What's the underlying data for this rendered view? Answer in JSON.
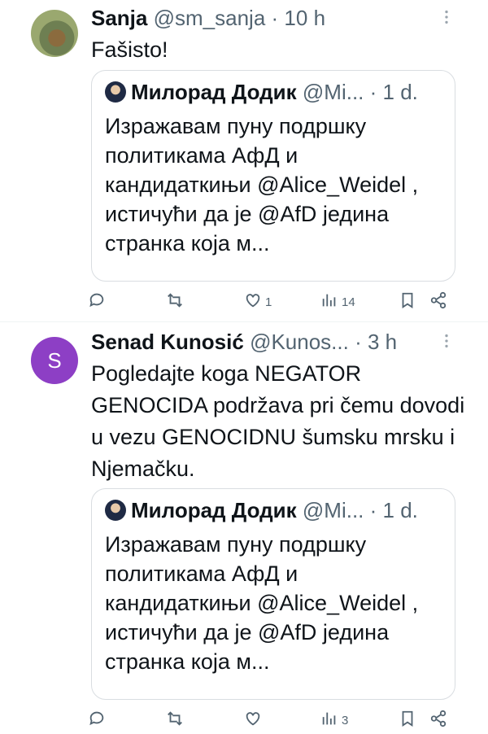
{
  "tweets": [
    {
      "name": "Sanja",
      "handle": "@sm_sanja",
      "sep": "·",
      "time": "10 h",
      "avatar_letter": "",
      "text": "Fašisto!",
      "quote": {
        "name": "Милорад Додик",
        "handle": "@Mi...",
        "sep": "·",
        "time": "1 d.",
        "text": "Изражавам пуну подршку политикама АфД и кандидаткињи @Alice_Weidel , истичући да је @AfD једина странка која м..."
      },
      "actions": {
        "reply": "",
        "retweet": "",
        "like": "1",
        "views": "14"
      }
    },
    {
      "name": "Senad Kunosić",
      "handle": "@Kunos...",
      "sep": "·",
      "time": "3 h",
      "avatar_letter": "S",
      "text": "Pogledajte koga NEGATOR GENOCIDA podržava pri čemu dovodi u vezu GENOCIDNU šumsku mrsku i Njemačku.",
      "quote": {
        "name": "Милорад Додик",
        "handle": "@Mi...",
        "sep": "·",
        "time": "1 d.",
        "text": "Изражавам пуну подршку политикама АфД и кандидаткињи @Alice_Weidel , истичући да је @AfD једина странка која м..."
      },
      "actions": {
        "reply": "",
        "retweet": "",
        "like": "",
        "views": "3"
      }
    }
  ],
  "icons": [
    "more-icon",
    "reply-icon",
    "retweet-icon",
    "like-icon",
    "views-icon",
    "bookmark-icon",
    "share-icon"
  ],
  "colors": {
    "text": "#0f1419",
    "muted": "#536471",
    "avatar_s": "#8d3fc5",
    "border": "#d9dde1"
  }
}
